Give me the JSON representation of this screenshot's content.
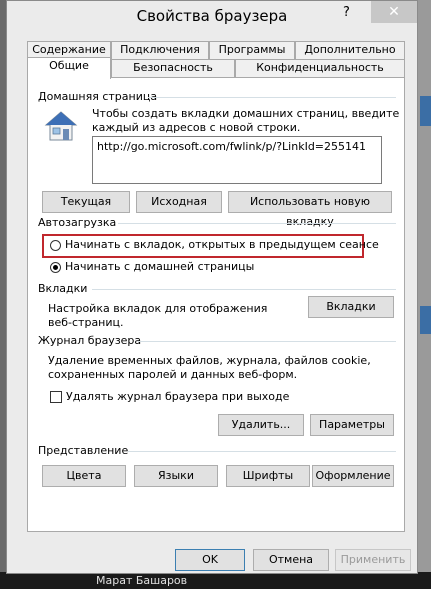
{
  "window": {
    "title": "Свойства браузера",
    "help": "?",
    "close": "✕"
  },
  "tabs": {
    "row1": [
      "Содержание",
      "Подключения",
      "Программы",
      "Дополнительно"
    ],
    "row2": [
      "Общие",
      "Безопасность",
      "Конфиденциальность"
    ],
    "active": "Общие"
  },
  "home": {
    "section": "Домашняя страница",
    "description_line1": "Чтобы создать вкладки домашних страниц, введите",
    "description_line2": "каждый из адресов с новой строки.",
    "url": "http://go.microsoft.com/fwlink/p/?LinkId=255141",
    "btn_current": "Текущая",
    "btn_default": "Исходная",
    "btn_new_tab": "Использовать новую вкладку"
  },
  "startup": {
    "section": "Автозагрузка",
    "option_tabs": "Начинать с вкладок, открытых в предыдущем сеансе",
    "option_home": "Начинать с домашней страницы",
    "selected": "Начинать с домашней страницы"
  },
  "tabs_section": {
    "section": "Вкладки",
    "description_line1": "Настройка вкладок для отображения",
    "description_line2": "веб-страниц.",
    "button": "Вкладки"
  },
  "history": {
    "section": "Журнал браузера",
    "description_line1": "Удаление временных файлов, журнала, файлов cookie,",
    "description_line2": "сохраненных паролей и данных веб-форм.",
    "checkbox": "Удалять журнал браузера при выходе",
    "checked": false,
    "btn_delete": "Удалить...",
    "btn_settings": "Параметры"
  },
  "appearance": {
    "section": "Представление",
    "btn_colors": "Цвета",
    "btn_languages": "Языки",
    "btn_fonts": "Шрифты",
    "btn_accessibility": "Оформление"
  },
  "footer": {
    "ok": "OK",
    "cancel": "Отмена",
    "apply": "Применить"
  },
  "background": {
    "taskbar_text": "Марат Башаров"
  },
  "colors": {
    "highlight_border": "#c0272d",
    "primary_button_border": "#3c7fb1"
  }
}
